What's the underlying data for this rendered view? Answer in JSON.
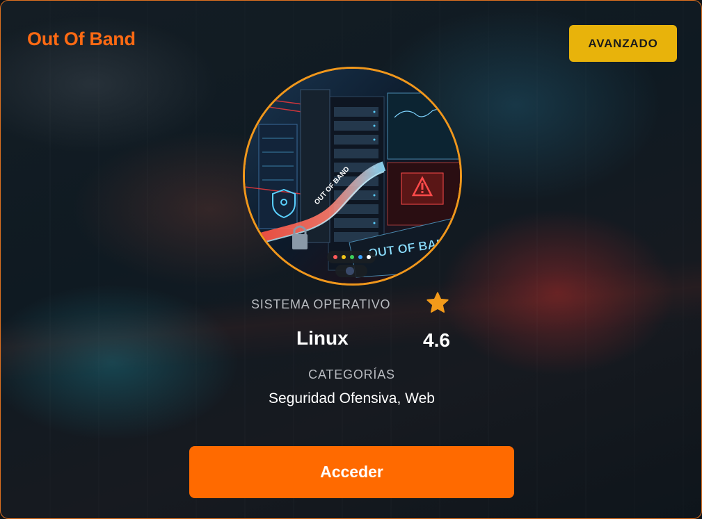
{
  "card": {
    "title": "Out Of Band",
    "difficulty": "AVANZADO",
    "image": {
      "description_icon": "server-room-illustration",
      "sign_text": "OUT OF BAND",
      "cable_text": "OUT OF BAND"
    },
    "os_label": "SISTEMA OPERATIVO",
    "os_value": "Linux",
    "rating": "4.6",
    "categories_label": "CATEGORÍAS",
    "categories_value": "Seguridad Ofensiva, Web",
    "action_label": "Acceder"
  },
  "colors": {
    "accent": "#ff6a00",
    "badge": "#e8b30b",
    "star": "#f29a1a"
  }
}
